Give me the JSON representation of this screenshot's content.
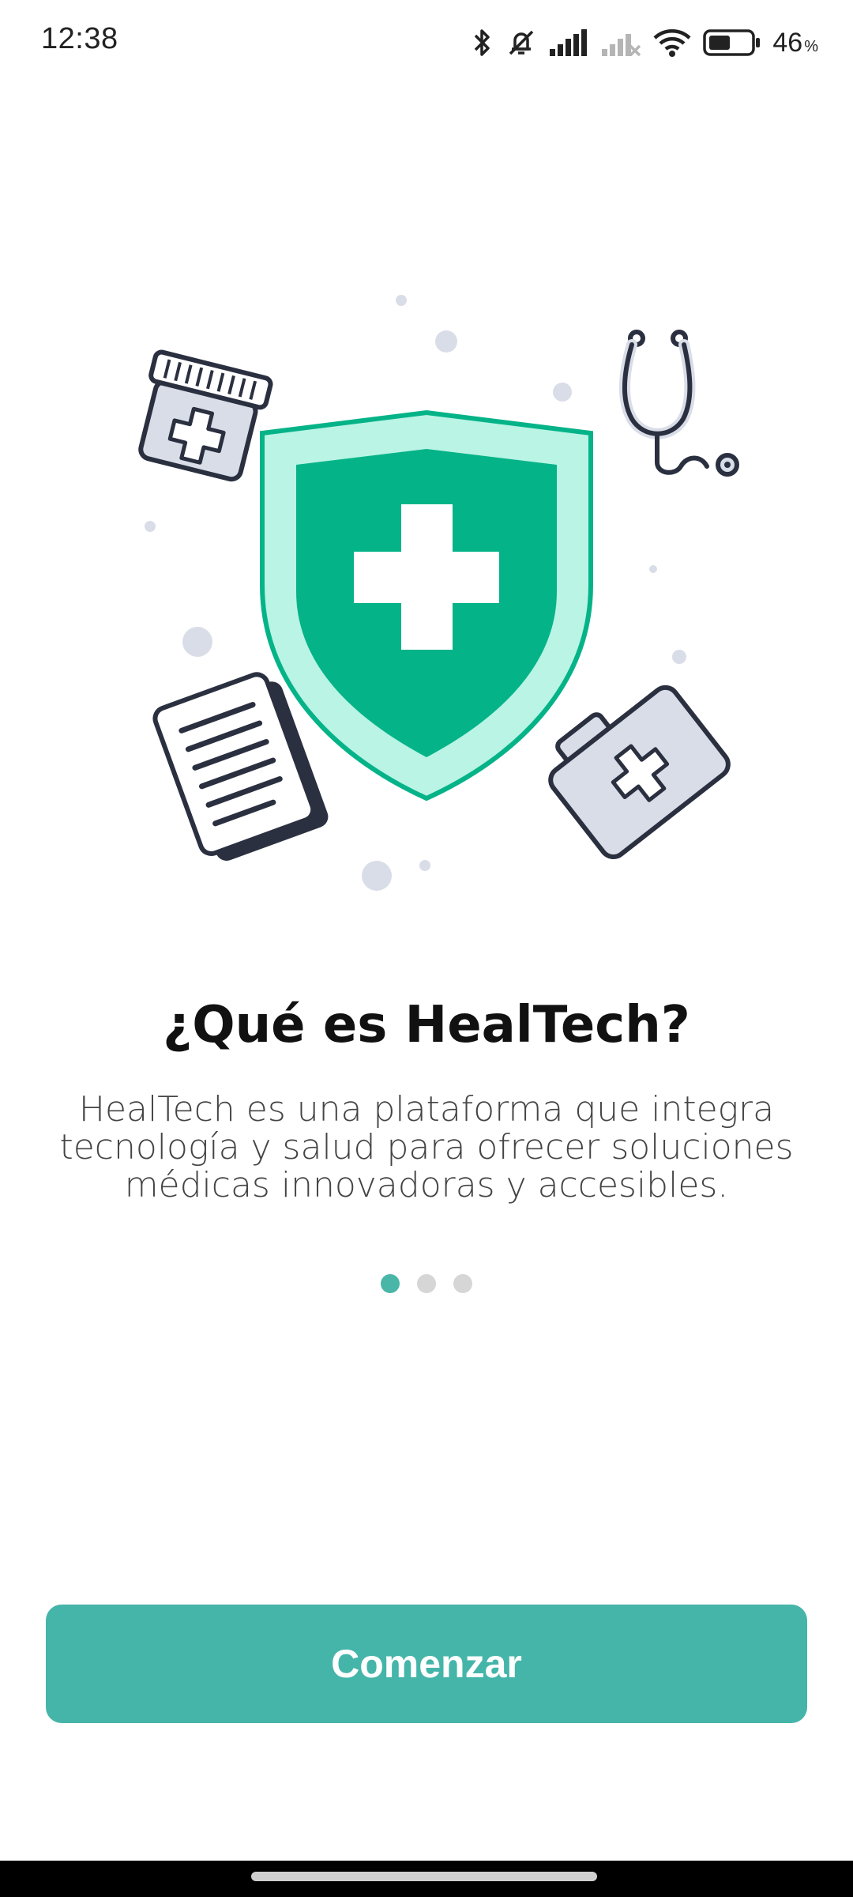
{
  "status_bar": {
    "time": "12:38",
    "battery_percent": "46",
    "battery_unit": "%",
    "icons": [
      "bluetooth-icon",
      "mute-bell-icon",
      "signal-icon",
      "signal-off-icon",
      "wifi-icon",
      "battery-icon"
    ]
  },
  "onboarding": {
    "illustration_icons": [
      "shield-cross-icon",
      "pill-bottle-icon",
      "stethoscope-icon",
      "documents-icon",
      "first-aid-kit-icon"
    ],
    "title": "¿Qué es HealTech?",
    "description": "HealTech es una plataforma que integra tecnología y salud para ofrecer soluciones médicas innovadoras y accesibles.",
    "page_indicator": {
      "total": 3,
      "active": 1
    }
  },
  "actions": {
    "start_label": "Comenzar"
  },
  "colors": {
    "accent": "#45b5a9",
    "shield_green": "#05b388",
    "shield_light": "#b9f4e4",
    "outline": "#2b3040",
    "object_fill": "#d9dde8"
  }
}
